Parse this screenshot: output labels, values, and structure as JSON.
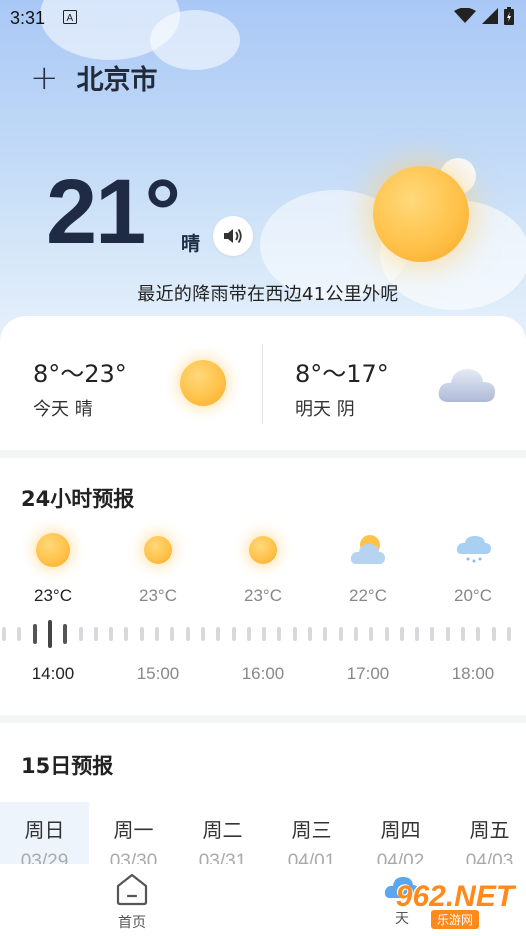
{
  "status_bar": {
    "time": "3:31"
  },
  "header": {
    "city": "北京市"
  },
  "current": {
    "temperature": "21°",
    "condition": "晴",
    "rain_note": "最近的降雨带在西边41公里外呢"
  },
  "daily_summary": [
    {
      "range": "8°～23°",
      "label": "今天  晴",
      "icon": "sun-icon"
    },
    {
      "range": "8°～17°",
      "label": "明天  阴",
      "icon": "cloud-icon"
    }
  ],
  "hourly": {
    "title": "24小时预报",
    "items": [
      {
        "temp": "23°C",
        "time": "14:00",
        "icon": "sun-icon"
      },
      {
        "temp": "23°C",
        "time": "15:00",
        "icon": "sun-icon"
      },
      {
        "temp": "23°C",
        "time": "16:00",
        "icon": "sun-icon"
      },
      {
        "temp": "22°C",
        "time": "17:00",
        "icon": "partly-cloudy-icon"
      },
      {
        "temp": "20°C",
        "time": "18:00",
        "icon": "cloud-snow-icon"
      }
    ]
  },
  "forecast15": {
    "title": "15日预报",
    "days": [
      {
        "day": "周日",
        "date": "03/29"
      },
      {
        "day": "周一",
        "date": "03/30"
      },
      {
        "day": "周二",
        "date": "03/31"
      },
      {
        "day": "周三",
        "date": "04/01"
      },
      {
        "day": "周四",
        "date": "04/02"
      },
      {
        "day": "周五",
        "date": "04/03"
      }
    ]
  },
  "bottom_nav": {
    "home": "首页",
    "weather": "天"
  },
  "watermark": {
    "logo": "962.NET",
    "sub": "乐游网"
  },
  "colors": {
    "sun": "#ffc24a",
    "hero_top": "#a9c8f5",
    "accent_tab": "#eef4fc"
  }
}
